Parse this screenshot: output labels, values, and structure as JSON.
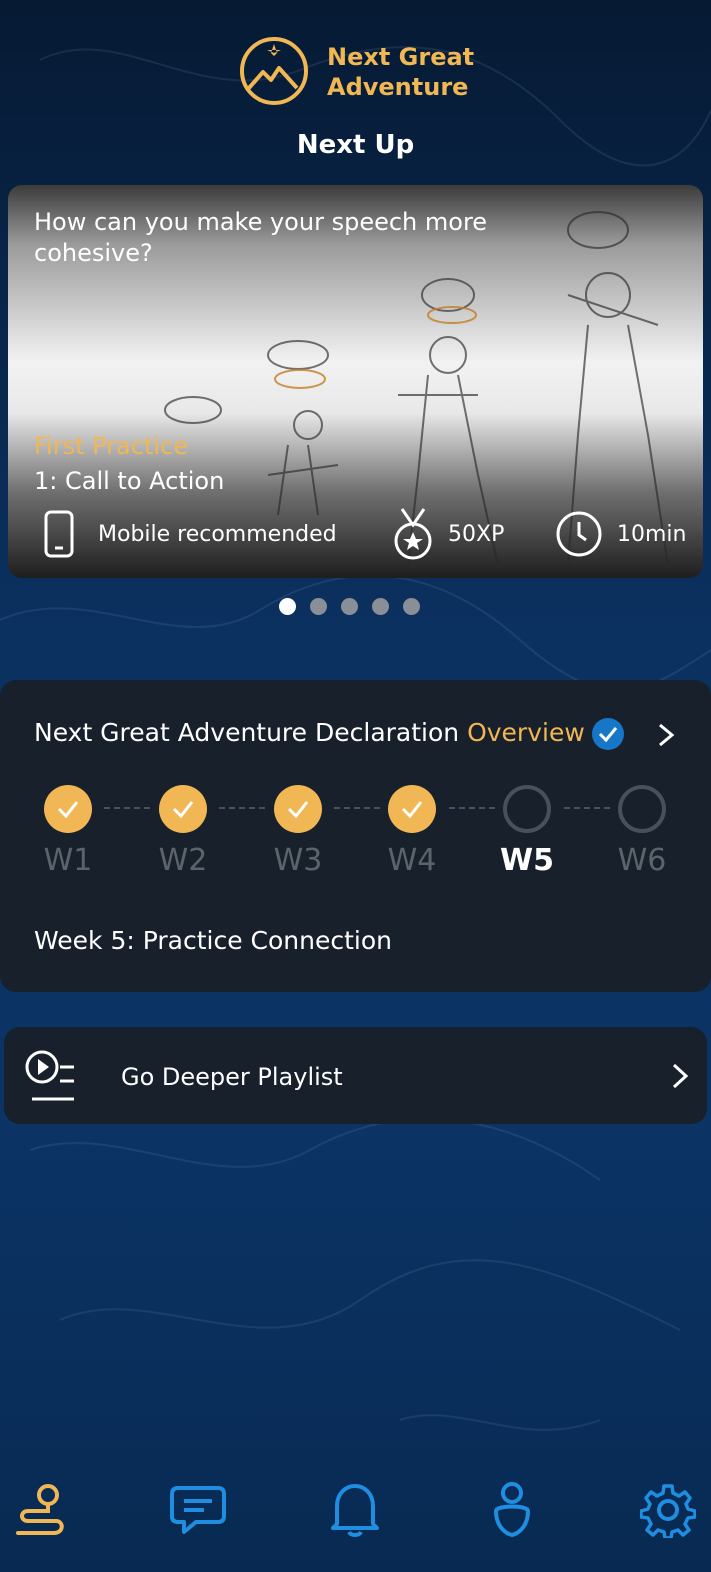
{
  "brand": {
    "line1": "Next Great",
    "line2": "Adventure"
  },
  "section_title": "Next Up",
  "hero": {
    "question": "How can you make your speech more cohesive?",
    "kicker": "First Practice",
    "title": "1: Call to Action",
    "device_label": "Mobile recommended",
    "xp_label": "50XP",
    "duration_label": "10min"
  },
  "carousel": {
    "count": 5,
    "active_index": 0
  },
  "course": {
    "title": "Next Great Adventure Declaration",
    "overview": "Overview",
    "weeks": [
      {
        "label": "W1",
        "status": "done"
      },
      {
        "label": "W2",
        "status": "done"
      },
      {
        "label": "W3",
        "status": "done"
      },
      {
        "label": "W4",
        "status": "done"
      },
      {
        "label": "W5",
        "status": "current"
      },
      {
        "label": "W6",
        "status": "todo"
      }
    ],
    "current_week_title": "Week 5: Practice Connection"
  },
  "playlist": {
    "label": "Go Deeper Playlist"
  },
  "tabbar": {
    "items": [
      "journey-icon",
      "chat-icon",
      "bell-icon",
      "profile-icon",
      "gear-icon"
    ],
    "active_index": 0
  },
  "colors": {
    "accent": "#f1b754",
    "card": "#18202b",
    "tab_icon": "#1f8de0",
    "verified": "#1677c9"
  }
}
